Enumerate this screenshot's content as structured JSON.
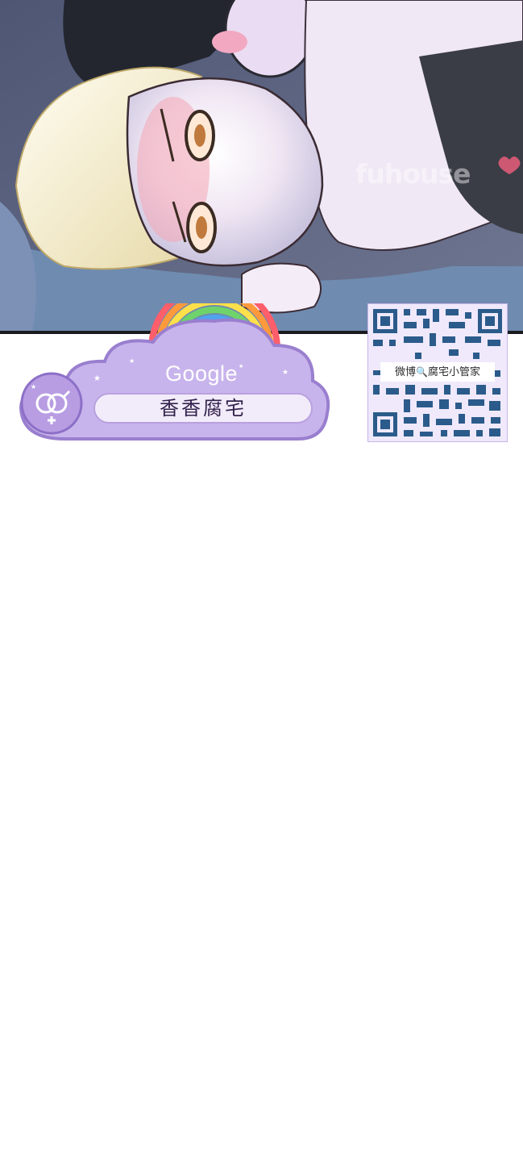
{
  "comic_panel": {
    "watermark": "fuhouse"
  },
  "banner": {
    "search_engine": "Google",
    "search_query": "香香腐宅",
    "qr_caption_prefix": "微博",
    "qr_caption_suffix": "腐宅小管家",
    "icons": [
      "gender-symbol-icon",
      "magnifier-icon",
      "rainbow-icon",
      "qr-code"
    ],
    "colors": {
      "cloud": "#c8b4ec",
      "cloud_border": "#9a7fcf",
      "search_box": "#f2ecfa",
      "qr_dark": "#2b5b8a",
      "qr_frame": "#efe9fb"
    }
  }
}
